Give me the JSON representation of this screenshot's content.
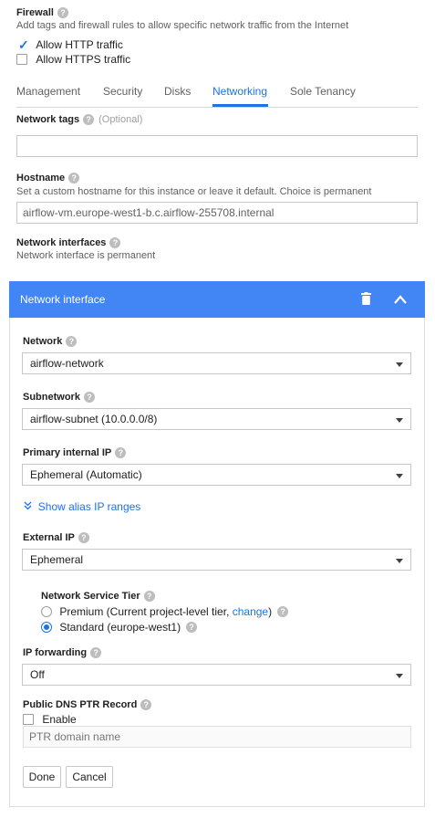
{
  "firewall": {
    "title": "Firewall",
    "description": "Add tags and firewall rules to allow specific network traffic from the Internet",
    "http_label": "Allow HTTP traffic",
    "https_label": "Allow HTTPS traffic"
  },
  "tabs": [
    "Management",
    "Security",
    "Disks",
    "Networking",
    "Sole Tenancy"
  ],
  "network_tags": {
    "label": "Network tags",
    "optional": "(Optional)",
    "value": ""
  },
  "hostname": {
    "label": "Hostname",
    "description": "Set a custom hostname for this instance or leave it default. Choice is permanent",
    "value": "airflow-vm.europe-west1-b.c.airflow-255708.internal"
  },
  "network_interfaces": {
    "label": "Network interfaces",
    "description": "Network interface is permanent"
  },
  "panel": {
    "title": "Network interface",
    "network": {
      "label": "Network",
      "value": "airflow-network"
    },
    "subnetwork": {
      "label": "Subnetwork",
      "value": "airflow-subnet (10.0.0.0/8)"
    },
    "primary_ip": {
      "label": "Primary internal IP",
      "value": "Ephemeral (Automatic)"
    },
    "alias_link": "Show alias IP ranges",
    "external_ip": {
      "label": "External IP",
      "value": "Ephemeral"
    },
    "tier": {
      "label": "Network Service Tier",
      "premium_text": "Premium (Current project-level tier, ",
      "change_link": "change",
      "premium_close": ")",
      "standard_text": "Standard (europe-west1)"
    },
    "ip_forwarding": {
      "label": "IP forwarding",
      "value": "Off"
    },
    "dns": {
      "label": "Public DNS PTR Record",
      "enable_label": "Enable",
      "placeholder": "PTR domain name"
    },
    "done_label": "Done",
    "cancel_label": "Cancel"
  },
  "colors": {
    "accent": "#1a73e8",
    "panel_header": "#4285f4"
  }
}
